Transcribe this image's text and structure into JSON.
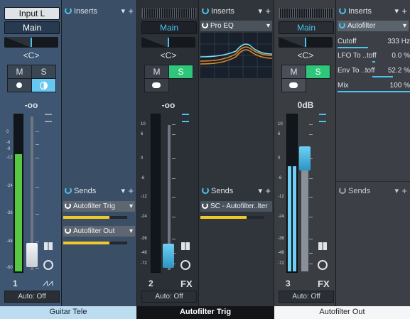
{
  "channels": [
    {
      "input": "Input L",
      "output": "Main",
      "pan": "<C>",
      "mute": "M",
      "solo": "S",
      "volume": "-oo",
      "scale_meter": [
        "0",
        "-6",
        "-9",
        "-12",
        "-24",
        "-36",
        "-48",
        "-60"
      ],
      "number": "1",
      "automation": "Auto: Off",
      "name": "Guitar Tele",
      "inserts_label": "Inserts",
      "sends_label": "Sends",
      "sends": [
        "Autofilter Trig",
        "Autofilter Out"
      ]
    },
    {
      "output": "Main",
      "pan": "<C>",
      "mute": "M",
      "solo": "S",
      "volume": "-oo",
      "scale_meter": [
        "10",
        "6",
        "0",
        "-6",
        "-12",
        "-24",
        "-36",
        "-48",
        "-72"
      ],
      "number": "2",
      "type_label": "FX",
      "automation": "Auto: Off",
      "name": "Autofilter Trig",
      "inserts_label": "Inserts",
      "insert_plugin": "Pro EQ",
      "sends_label": "Sends",
      "sends": [
        "SC - Autofilter..lter"
      ]
    },
    {
      "output": "Main",
      "pan": "<C>",
      "mute": "M",
      "solo": "S",
      "volume": "0dB",
      "scale_meter": [
        "10",
        "6",
        "0",
        "-6",
        "-12",
        "-24",
        "-36",
        "-48",
        "-72"
      ],
      "number": "3",
      "type_label": "FX",
      "automation": "Auto: Off",
      "name": "Autofilter Out",
      "inserts_label": "Inserts",
      "insert_plugin": "Autofilter",
      "params": [
        {
          "label": "Cutoff",
          "value": "333 Hz",
          "fill": 0.42
        },
        {
          "label": "LFO To ..toff",
          "value": "0.0 %",
          "fill": 0.5
        },
        {
          "label": "Env To ..toff",
          "value": "52.2 %",
          "fill": 0.76
        },
        {
          "label": "Mix",
          "value": "100 %",
          "fill": 1.0
        }
      ],
      "sends_label": "Sends"
    }
  ],
  "colors": {
    "accent": "#4cc3f0",
    "solo_active": "#2ec77a",
    "send_level": "#f0c82a",
    "meter": "#56c940"
  }
}
